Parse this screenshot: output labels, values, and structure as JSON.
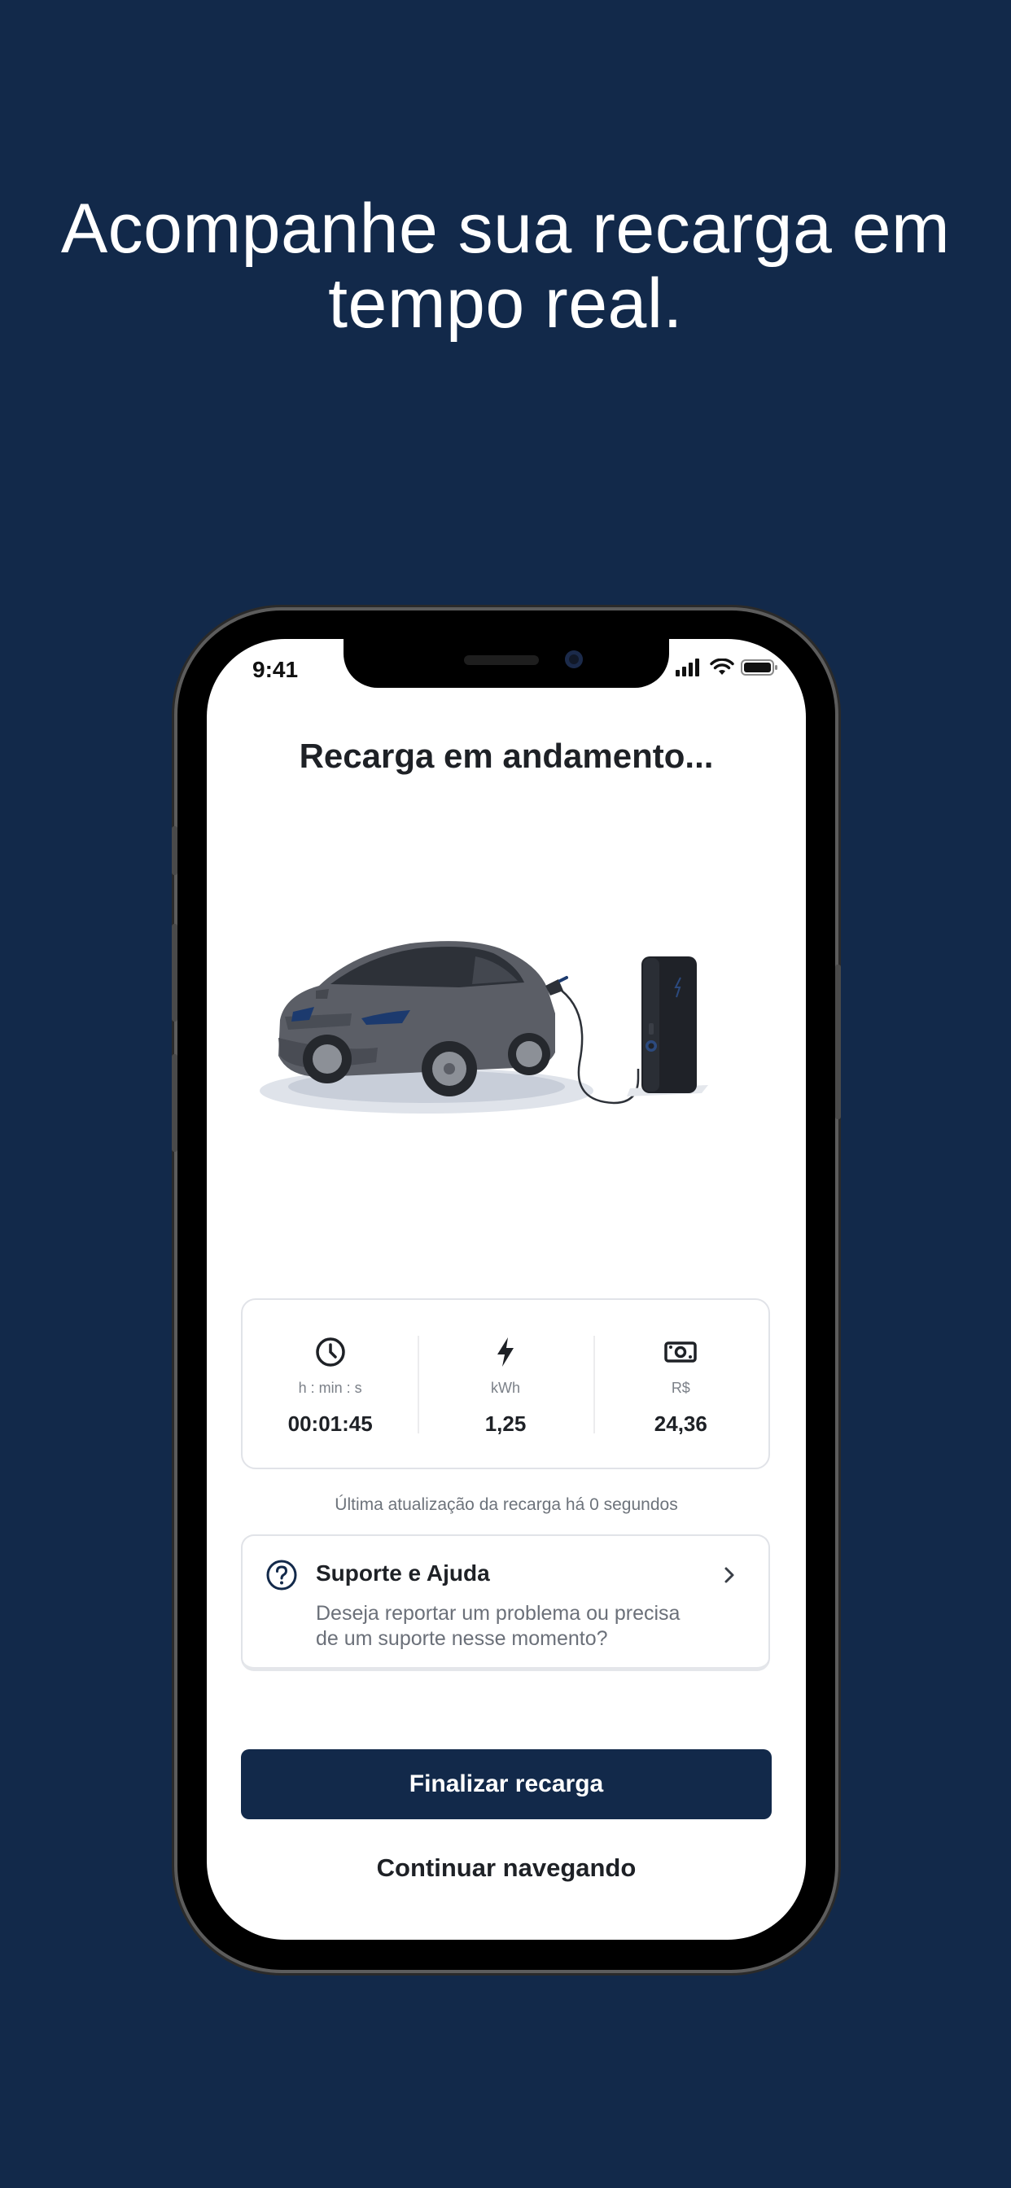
{
  "promo": {
    "headline_line1": "Acompanhe sua recarga em",
    "headline_line2": "tempo real."
  },
  "status_bar": {
    "time": "9:41",
    "icons": [
      "signal-icon",
      "wifi-icon",
      "battery-icon"
    ]
  },
  "screen": {
    "title": "Recarga em andamento...",
    "illustration": "car-charging-illustration",
    "stats": [
      {
        "icon": "clock-icon",
        "label": "h : min : s",
        "value": "00:01:45"
      },
      {
        "icon": "lightning-icon",
        "label": "kWh",
        "value": "1,25"
      },
      {
        "icon": "money-icon",
        "label": "R$",
        "value": "24,36"
      }
    ],
    "last_update": "Última atualização da recarga há 0 segundos",
    "support": {
      "icon": "help-circle-icon",
      "title": "Suporte e Ajuda",
      "description": "Deseja reportar um problema ou precisa de um suporte nesse momento?"
    },
    "primary_button": "Finalizar recarga",
    "secondary_button": "Continuar navegando"
  },
  "colors": {
    "background": "#12294a",
    "primary": "#12294a",
    "text": "#1e2126",
    "muted": "#6b7079"
  }
}
